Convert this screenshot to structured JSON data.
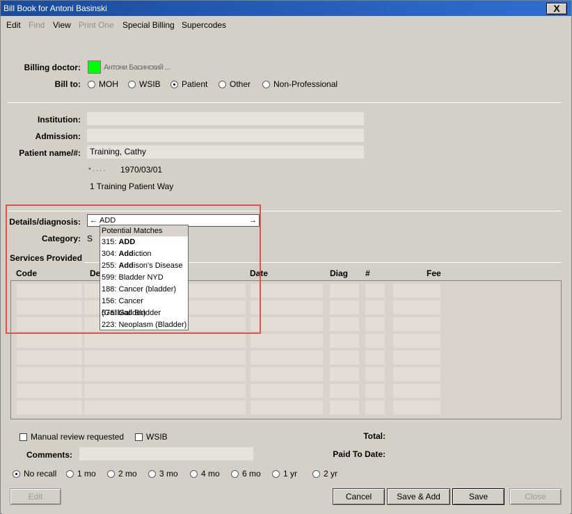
{
  "window": {
    "title": "Bill Book for Antoni Basinski",
    "close_label": "X"
  },
  "menu": [
    {
      "label": "Edit",
      "enabled": true
    },
    {
      "label": "Find",
      "enabled": false
    },
    {
      "label": "View",
      "enabled": true
    },
    {
      "label": "Print One",
      "enabled": false
    },
    {
      "label": "Special Billing",
      "enabled": true
    },
    {
      "label": "Supercodes",
      "enabled": true
    }
  ],
  "billing": {
    "doctor_label": "Billing doctor:",
    "doctor_color": "#00ff00",
    "doctor_name": "Антони Басинский  ...",
    "bill_to_label": "Bill to:",
    "bill_to_options": [
      "MOH",
      "WSIB",
      "Patient",
      "Other",
      "Non-Professional"
    ],
    "bill_to_selected": "Patient"
  },
  "patient": {
    "institution_label": "Institution:",
    "institution_value": "",
    "admission_label": "Admission:",
    "admission_value": "",
    "name_label": "Patient name/#:",
    "name_value": "Training, Cathy",
    "hcn": "• . . . .",
    "dob": "1970/03/01",
    "address": "1 Training Patient Way"
  },
  "details": {
    "label": "Details/diagnosis:",
    "value": "ADD",
    "category_label": "Category:",
    "category_value": "S",
    "services_label": "Services Provided"
  },
  "dropdown": {
    "header": "Potential Matches",
    "items": [
      {
        "code": "315:",
        "bold": "ADD",
        "rest": ""
      },
      {
        "code": "304:",
        "bold": "Add",
        "rest": "iction"
      },
      {
        "code": "255:",
        "bold": "Add",
        "rest": "ison's Disease"
      },
      {
        "code": "599:",
        "bold": "",
        "rest": "Bladder NYD"
      },
      {
        "code": "188:",
        "bold": "",
        "rest": "Cancer (bladder)"
      },
      {
        "code": "156:",
        "bold": "",
        "rest": "Cancer (Gallbladder)"
      },
      {
        "code": "576:",
        "bold": "",
        "rest": "Gall Bladder"
      },
      {
        "code": "223:",
        "bold": "",
        "rest": "Neoplasm (Bladder)"
      }
    ]
  },
  "table": {
    "headers": [
      "Code",
      "De",
      "Date",
      "Diag",
      "#",
      "Fee"
    ]
  },
  "footer": {
    "manual_review_label": "Manual review requested",
    "wsib_label": "WSIB",
    "total_label": "Total:",
    "paid_label": "Paid To Date:",
    "comments_label": "Comments:",
    "recall_options": [
      "No recall",
      "1 mo",
      "2 mo",
      "3 mo",
      "4 mo",
      "6 mo",
      "1 yr",
      "2 yr"
    ],
    "recall_selected": "No recall"
  },
  "buttons": {
    "edit": "Edit",
    "cancel": "Cancel",
    "save_add": "Save & Add",
    "save": "Save",
    "close": "Close"
  }
}
